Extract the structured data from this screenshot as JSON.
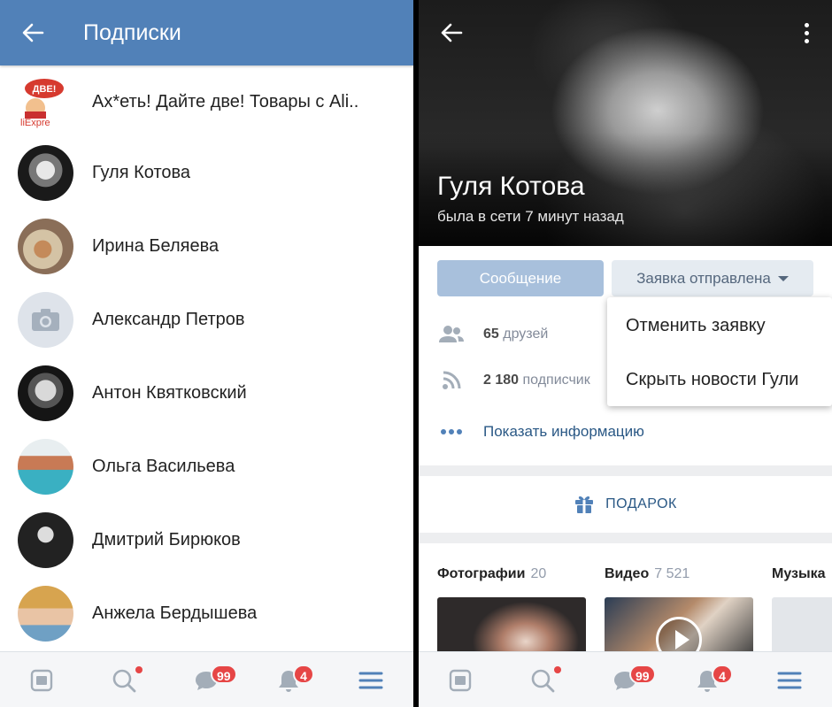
{
  "left": {
    "title": "Подписки",
    "subscriptions": [
      {
        "name": "Ах*еть! Дайте две! Товары с Ali..",
        "avatar_text_top": "ДВЕ!",
        "avatar_text_bottom": "liExpre"
      },
      {
        "name": "Гуля Котова"
      },
      {
        "name": "Ирина Беляева"
      },
      {
        "name": "Александр Петров"
      },
      {
        "name": "Антон Квятковский"
      },
      {
        "name": "Ольга Васильева"
      },
      {
        "name": "Дмитрий Бирюков"
      },
      {
        "name": "Анжела Бердышева"
      }
    ]
  },
  "nav": {
    "messages_badge": "99",
    "notifications_badge": "4",
    "icons": [
      "news-icon",
      "search-icon",
      "messages-icon",
      "notifications-icon",
      "menu-icon"
    ]
  },
  "profile": {
    "name": "Гуля Котова",
    "status": "была в сети 7 минут назад",
    "message_button": "Сообщение",
    "request_button": "Заявка отправлена",
    "friends_count": "65",
    "friends_label": "друзей",
    "followers_count": "2 180",
    "followers_label": "подписчик",
    "show_info": "Показать информацию",
    "dropdown": {
      "cancel_request": "Отменить заявку",
      "hide_news": "Скрыть новости Гули"
    },
    "gift_label": "ПОДАРОК",
    "media": {
      "photos_label": "Фотографии",
      "photos_count": "20",
      "videos_label": "Видео",
      "videos_count": "7 521",
      "music_label": "Музыка"
    }
  },
  "colors": {
    "header": "#5181b8",
    "link": "#2a5885",
    "badge": "#e64646",
    "nav_icon": "#a3adb8",
    "menu_active": "#5181b8"
  }
}
